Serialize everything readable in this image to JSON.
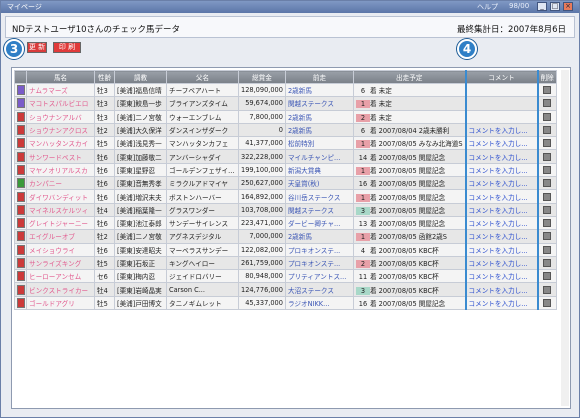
{
  "window": {
    "title": "マイページ",
    "menu_help": "ヘルプ",
    "menu_extra": "98/00"
  },
  "header": {
    "title": "NDテストユーザ10さんのチェック馬データ",
    "last_tally": "最終集計日：2007年8月6日"
  },
  "toolbar": {
    "btn1_label": "更 新",
    "btn2_label": "印 刷"
  },
  "annotations": {
    "badge3": "3",
    "badge4": "4"
  },
  "table": {
    "columns": [
      "",
      "馬名",
      "性齢",
      "調教",
      "父名",
      "総賞金",
      "前走",
      "出走予定",
      "コメント",
      "削除"
    ],
    "rows": [
      {
        "icon_color": "#7a5cc9",
        "name": "ナムラマーズ",
        "sex": "牡3",
        "trainer": "[美浦]福島信晴",
        "sire": "チーフベアハート",
        "prize": "128,090,000",
        "prev": "2歳新馬",
        "rank": "6",
        "rank_color": "",
        "plan": "未定",
        "comment": ""
      },
      {
        "icon_color": "#7a5cc9",
        "name": "マコトスパルビエロ",
        "sex": "牡3",
        "trainer": "[栗東]鮫島一歩",
        "sire": "ブライアンズタイム",
        "prize": "59,674,000",
        "prev": "関越ステークス",
        "rank": "1",
        "rank_color": "#e8a0a8",
        "plan": "未定",
        "comment": ""
      },
      {
        "icon_color": "#cc3a3a",
        "name": "ショウナンアルバ",
        "sex": "牡3",
        "trainer": "[美浦]二ノ宮敬",
        "sire": "ウォーエンブレム",
        "prize": "7,800,000",
        "prev": "2歳新馬",
        "rank": "2",
        "rank_color": "#e8a0a8",
        "plan": "未定",
        "comment": ""
      },
      {
        "icon_color": "#cc3a3a",
        "name": "ショウナンアクロス",
        "sex": "牡2",
        "trainer": "[美浦]大久保洋",
        "sire": "ダンスインザダーク",
        "prize": "0",
        "prev": "2歳新馬",
        "rank": "6",
        "rank_color": "",
        "plan": "2007/08/04 2歳未勝利",
        "comment": "コメントを入力し..."
      },
      {
        "icon_color": "#cc3a3a",
        "name": "マンハッタンスカイ",
        "sex": "牡5",
        "trainer": "[美浦]浅見秀一",
        "sire": "マンハッタンカフェ",
        "prize": "41,377,000",
        "prev": "松前特別",
        "rank": "1",
        "rank_color": "#e8a0a8",
        "plan": "2007/08/05 みなみ北海道S",
        "comment": "コメントを入力し..."
      },
      {
        "icon_color": "#cc3a3a",
        "name": "サンワードベスト",
        "sex": "牡6",
        "trainer": "[栗東]加藤敬二",
        "sire": "アンバーシャダイ",
        "prize": "322,228,000",
        "prev": "マイルチャンピ...",
        "rank": "14",
        "rank_color": "",
        "plan": "2007/08/05 関屋記念",
        "comment": "コメントを入力し..."
      },
      {
        "icon_color": "#cc3a3a",
        "name": "マヤノオリアルスカ",
        "sex": "牡6",
        "trainer": "[栗東]星野忍",
        "sire": "ゴールデンフェザイ...",
        "prize": "199,100,000",
        "prev": "新潟大賞典",
        "rank": "1",
        "rank_color": "#e8a0a8",
        "plan": "2007/08/05 関屋記念",
        "comment": "コメントを入力し..."
      },
      {
        "icon_color": "#3a9a3a",
        "name": "カンパニー",
        "sex": "牡6",
        "trainer": "[栗東]音無秀孝",
        "sire": "ミラクルアドマイヤ",
        "prize": "250,627,000",
        "prev": "天皇賞(秋)",
        "rank": "16",
        "rank_color": "",
        "plan": "2007/08/05 関屋記念",
        "comment": "コメントを入力し..."
      },
      {
        "icon_color": "#cc3a3a",
        "name": "ダイワバンディット",
        "sex": "牡6",
        "trainer": "[美浦]増沢末夫",
        "sire": "ボストンハーバー",
        "prize": "164,892,000",
        "prev": "谷川岳ステークス",
        "rank": "1",
        "rank_color": "#e8a0a8",
        "plan": "2007/08/05 関屋記念",
        "comment": "コメントを入力し..."
      },
      {
        "icon_color": "#cc3a3a",
        "name": "マイネルスケルツィ",
        "sex": "牡4",
        "trainer": "[美浦]稲葉隆一",
        "sire": "グラスワンダー",
        "prize": "103,708,000",
        "prev": "関越ステークス",
        "rank": "3",
        "rank_color": "#a8d8c8",
        "plan": "2007/08/05 関屋記念",
        "comment": "コメントを入力し..."
      },
      {
        "icon_color": "#cc3a3a",
        "name": "グレイトジャーニー",
        "sex": "牡6",
        "trainer": "[栗東]池江泰郎",
        "sire": "サンデーサイレンス",
        "prize": "223,471,000",
        "prev": "ダービー卿チャ...",
        "rank": "13",
        "rank_color": "",
        "plan": "2007/08/05 関屋記念",
        "comment": "コメントを入力し..."
      },
      {
        "icon_color": "#cc3a3a",
        "name": "エイグルーオブ",
        "sex": "牡2",
        "trainer": "[美浦]二ノ宮敬",
        "sire": "アグネスデジタル",
        "prize": "7,000,000",
        "prev": "2歳新馬",
        "rank": "1",
        "rank_color": "#e8a0a8",
        "plan": "2007/08/05 函館2歳S",
        "comment": "コメントを入力し..."
      },
      {
        "icon_color": "#cc3a3a",
        "name": "メイショウライ",
        "sex": "牡6",
        "trainer": "[栗東]安達昭夫",
        "sire": "マーベラスサンデー",
        "prize": "122,082,000",
        "prev": "プロキオンステ...",
        "rank": "4",
        "rank_color": "",
        "plan": "2007/08/05 KBC杯",
        "comment": "コメントを入力し..."
      },
      {
        "icon_color": "#cc3a3a",
        "name": "サンライズキング",
        "sex": "牡5",
        "trainer": "[栗東]石坂正",
        "sire": "キングヘイロー",
        "prize": "261,759,000",
        "prev": "プロキオンステ...",
        "rank": "2",
        "rank_color": "#e8a0a8",
        "plan": "2007/08/05 KBC杯",
        "comment": "コメントを入力し..."
      },
      {
        "icon_color": "#cc3a3a",
        "name": "ヒーローアンセム",
        "sex": "セ6",
        "trainer": "[栗東]梅内忍",
        "sire": "ジェイドロバリー",
        "prize": "80,948,000",
        "prev": "プリティアントス...",
        "rank": "11",
        "rank_color": "",
        "plan": "2007/08/05 KBC杯",
        "comment": "コメントを入力し..."
      },
      {
        "icon_color": "#cc3a3a",
        "name": "ビンクストライカー",
        "sex": "牡4",
        "trainer": "[栗東]岩崎晶実",
        "sire": "Carson C...",
        "prize": "124,776,000",
        "prev": "大沼ステークス",
        "rank": "3",
        "rank_color": "#a8d8c8",
        "plan": "2007/08/05 KBC杯",
        "comment": "コメントを入力し..."
      },
      {
        "icon_color": "#cc3a3a",
        "name": "ゴールドアグリ",
        "sex": "牡5",
        "trainer": "[美浦]戸田博文",
        "sire": "タニノギムレット",
        "prize": "45,337,000",
        "prev": "ラジオNIKK...",
        "rank": "16",
        "rank_color": "",
        "plan": "2007/08/05 関屋記念",
        "comment": "コメントを入力し..."
      }
    ]
  }
}
